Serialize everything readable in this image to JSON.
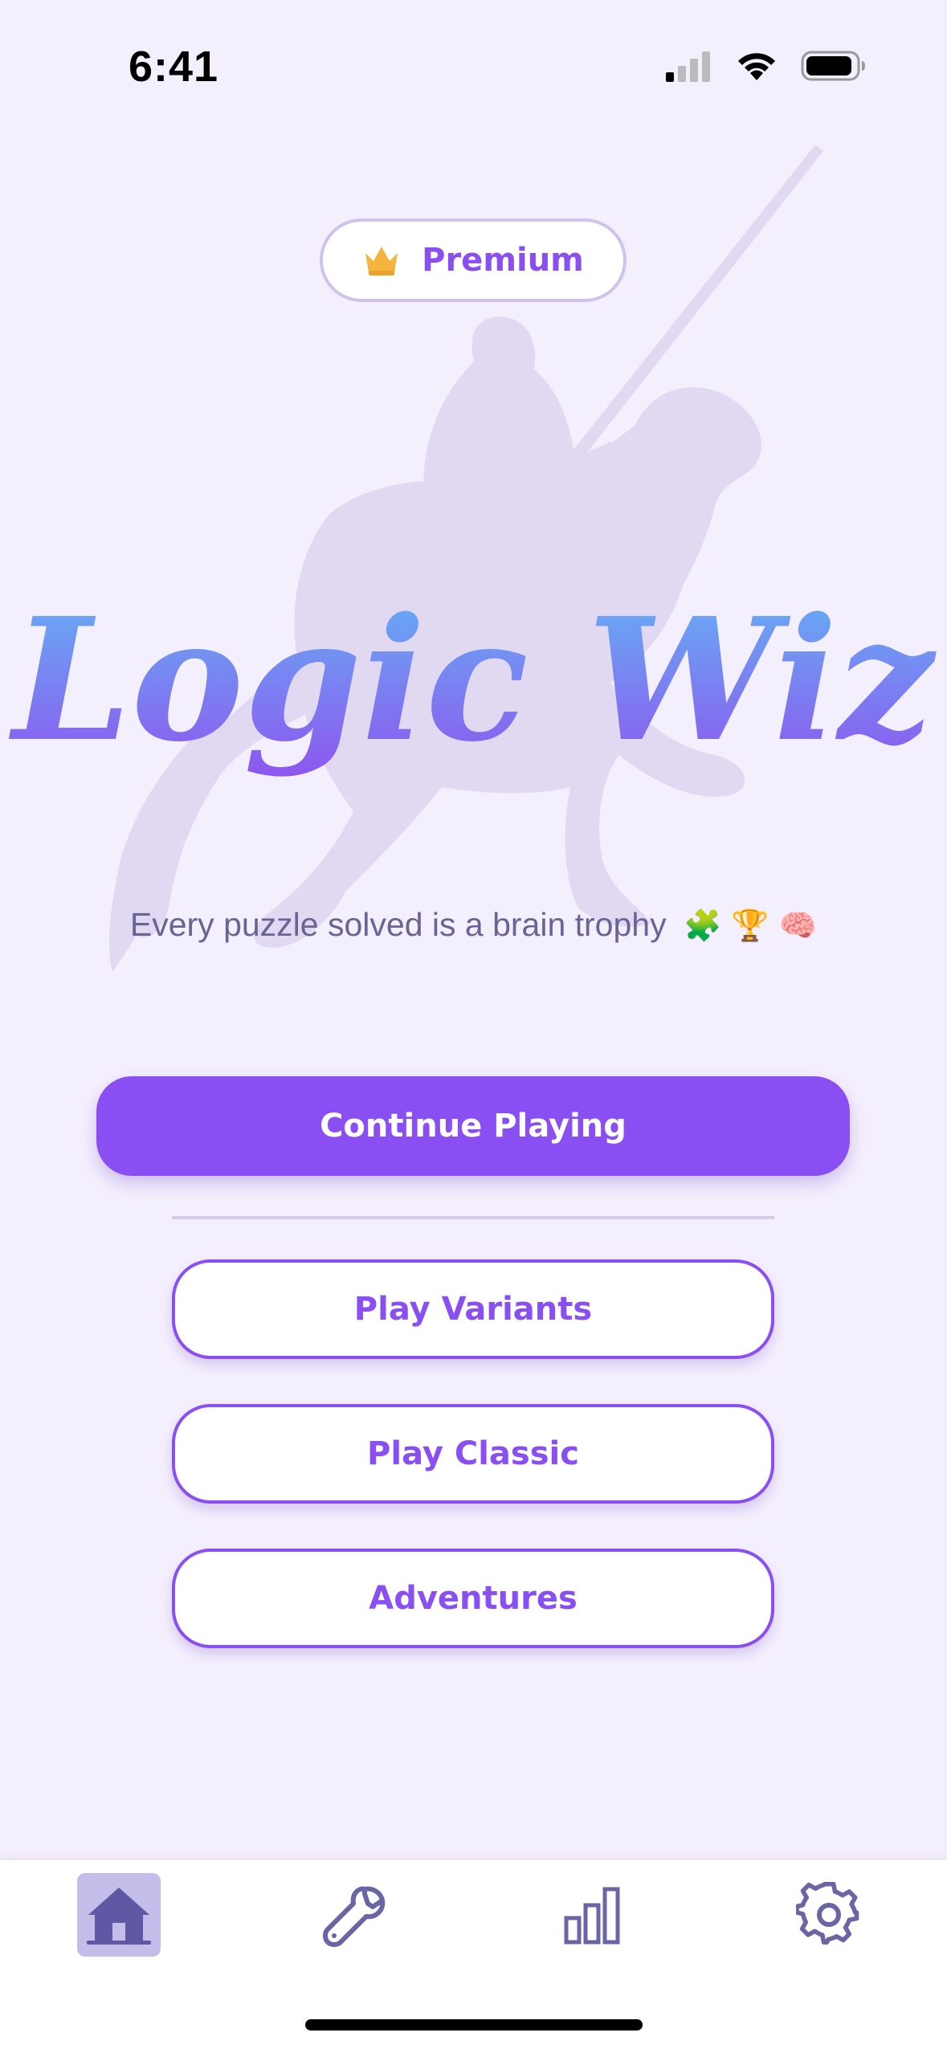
{
  "status_bar": {
    "time": "6:41"
  },
  "premium": {
    "label": "Premium",
    "icon": "crown-icon",
    "color": "#8a4ff0"
  },
  "logo": {
    "text": "Logic Wiz",
    "gradient_top": "#63b3f5",
    "gradient_bottom": "#8e55ee"
  },
  "tagline": {
    "text": "Every puzzle solved is a brain trophy",
    "emojis": "🧩 🏆 🧠"
  },
  "buttons": {
    "continue": "Continue Playing",
    "variants": "Play Variants",
    "classic": "Play Classic",
    "adventures": "Adventures"
  },
  "tab_bar": {
    "items": [
      {
        "name": "home",
        "icon": "home-icon",
        "active": true
      },
      {
        "name": "tools",
        "icon": "wrench-icon",
        "active": false
      },
      {
        "name": "stats",
        "icon": "bar-chart-icon",
        "active": false
      },
      {
        "name": "settings",
        "icon": "gear-icon",
        "active": false
      }
    ]
  },
  "colors": {
    "background": "#f4effd",
    "accent": "#8a4ff2",
    "tab_icon": "#6a65a4"
  }
}
